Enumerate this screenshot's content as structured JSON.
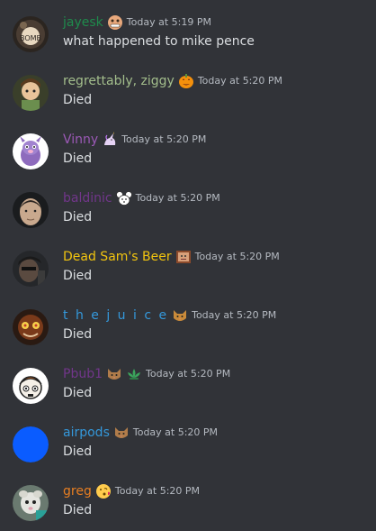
{
  "messages": [
    {
      "author": "jayesk",
      "color": "#1f8b4c",
      "badges": [
        "flexing-face-badge"
      ],
      "time": "Today at 5:19 PM",
      "text": "what happened to mike pence",
      "avatar": "jayesk-avatar"
    },
    {
      "author": "regrettably, ziggy",
      "color": "#a3be8c",
      "badges": [
        "jack-o-lantern-badge"
      ],
      "time": "Today at 5:20 PM",
      "text": "Died",
      "avatar": "ziggy-avatar"
    },
    {
      "author": "Vinny",
      "color": "#9b59b6",
      "badges": [
        "unicorn-badge"
      ],
      "time": "Today at 5:20 PM",
      "text": "Died",
      "avatar": "vinny-avatar"
    },
    {
      "author": "baldinic",
      "color": "#71368a",
      "badges": [
        "mouse-face-badge"
      ],
      "time": "Today at 5:20 PM",
      "text": "Died",
      "avatar": "baldinic-avatar"
    },
    {
      "author": "Dead Sam's Beer",
      "color": "#f1c40f",
      "badges": [
        "framed-face-badge"
      ],
      "time": "Today at 5:20 PM",
      "text": "Died",
      "avatar": "dead-sams-beer-avatar"
    },
    {
      "author": "t h e j u i c e",
      "color": "#3498db",
      "badges": [
        "cat-badge"
      ],
      "time": "Today at 5:20 PM",
      "text": "Died",
      "avatar": "thejuice-avatar"
    },
    {
      "author": "Pbub1",
      "color": "#71368a",
      "badges": [
        "cat-badge",
        "lotus-badge"
      ],
      "time": "Today at 5:20 PM",
      "text": "Died",
      "avatar": "pbub1-avatar"
    },
    {
      "author": "airpods",
      "color": "#3498db",
      "badges": [
        "cat-badge"
      ],
      "time": "Today at 5:20 PM",
      "text": "Died",
      "avatar": "airpods-avatar"
    },
    {
      "author": "greg",
      "color": "#e67e22",
      "badges": [
        "kissing-face-badge"
      ],
      "time": "Today at 5:20 PM",
      "text": "Died",
      "avatar": "greg-avatar"
    }
  ]
}
